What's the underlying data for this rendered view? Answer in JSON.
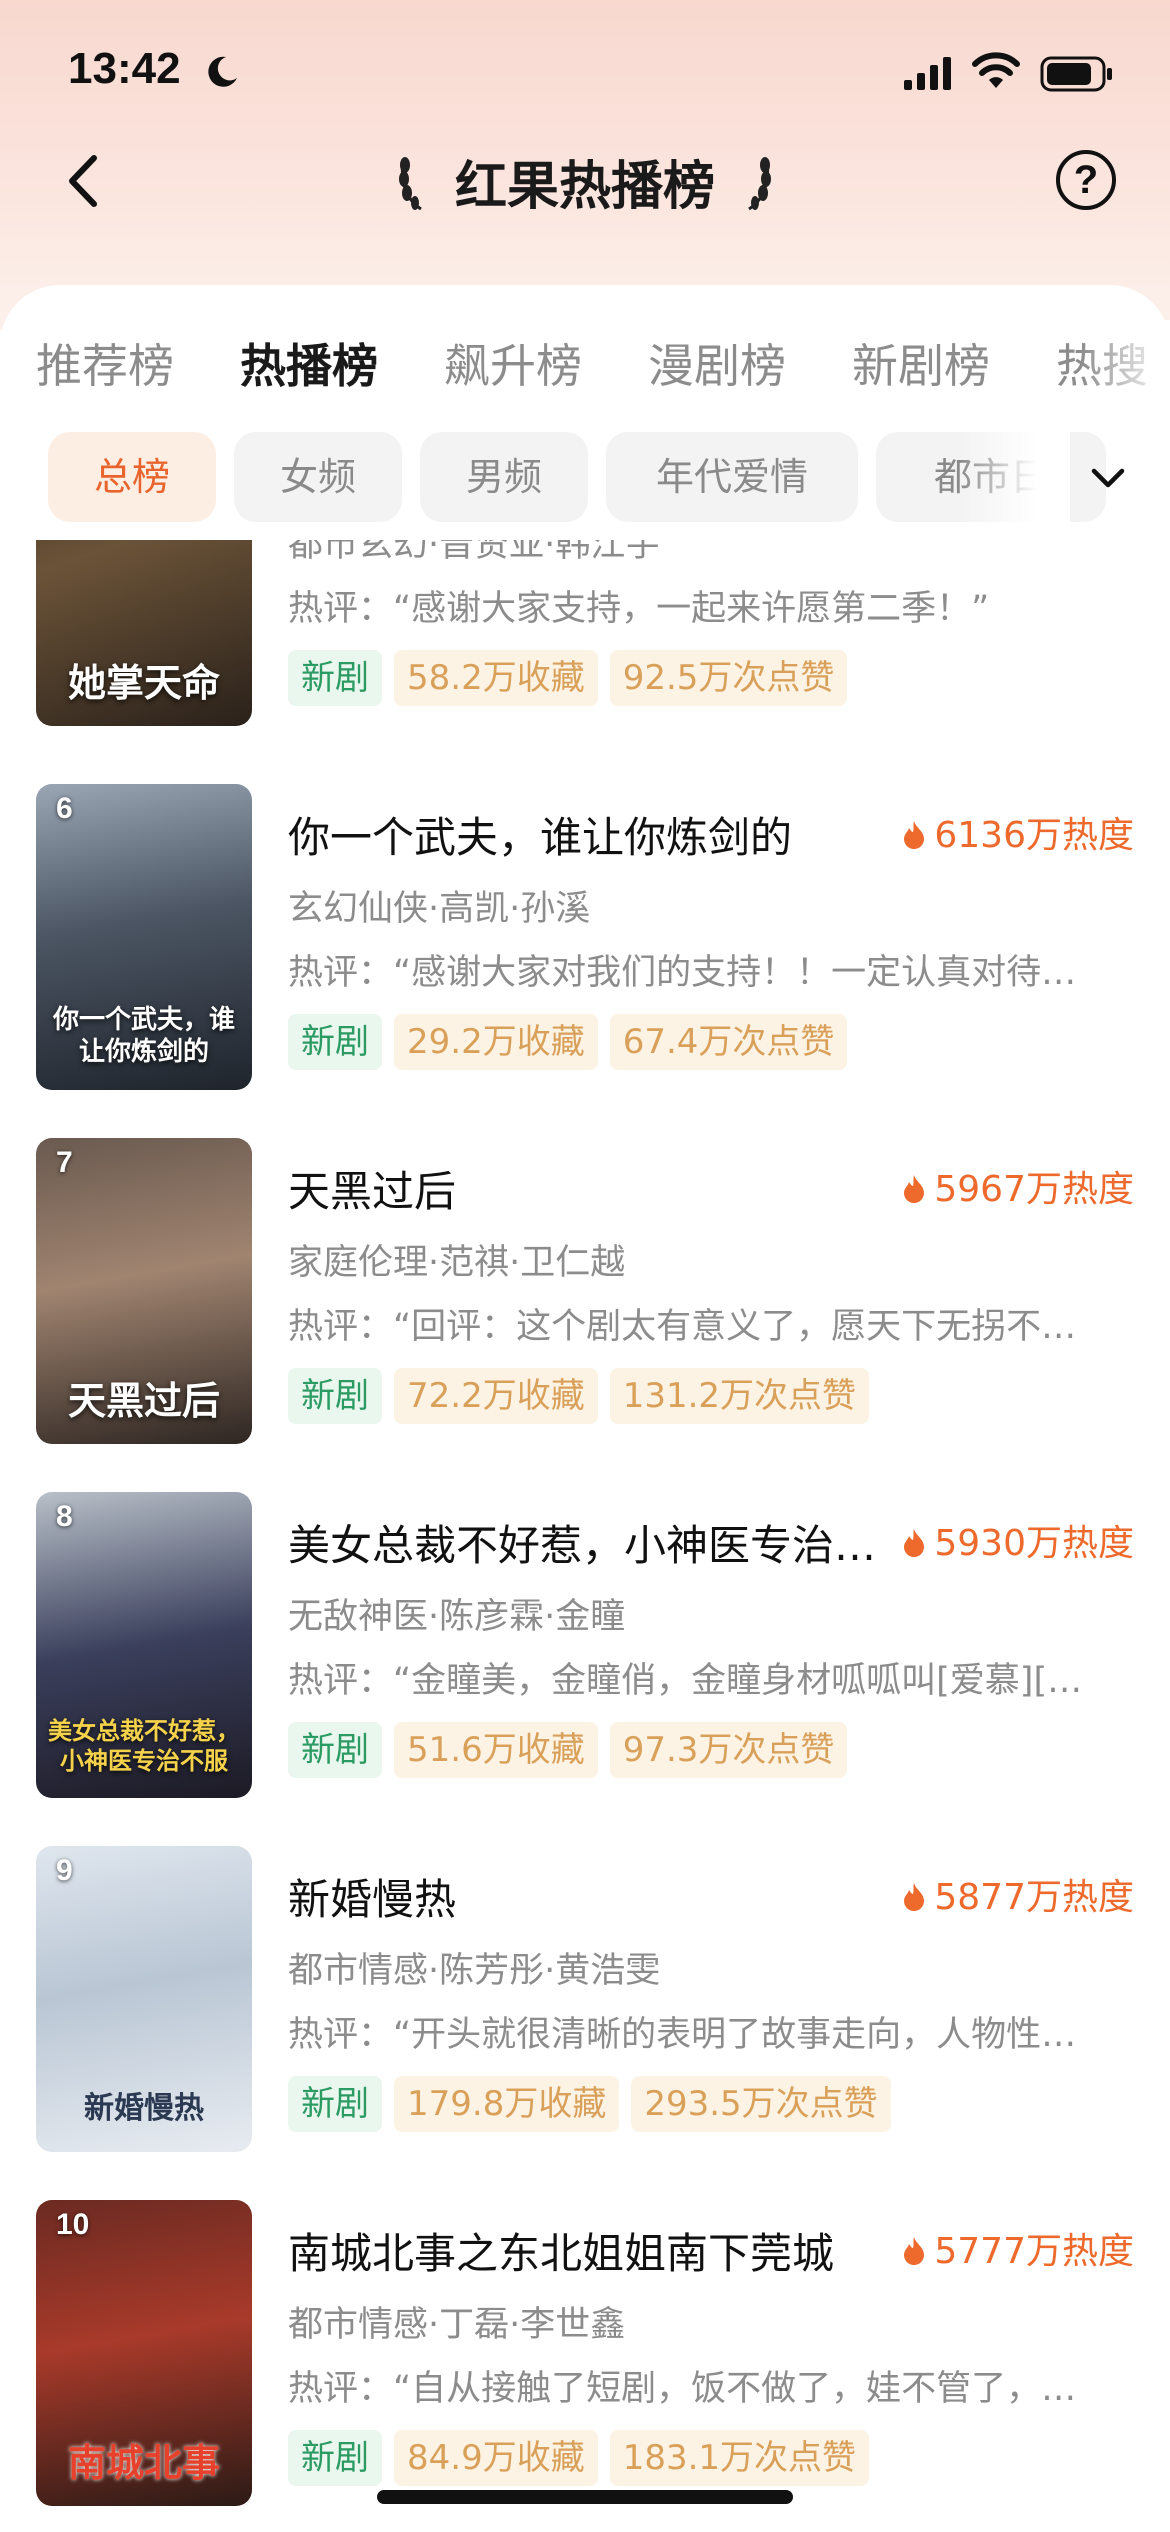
{
  "status_bar": {
    "time": "13:42"
  },
  "header": {
    "title": "红果热播榜"
  },
  "tabs": [
    {
      "label": "推荐榜",
      "active": false
    },
    {
      "label": "热播榜",
      "active": true
    },
    {
      "label": "飙升榜",
      "active": false
    },
    {
      "label": "漫剧榜",
      "active": false
    },
    {
      "label": "新剧榜",
      "active": false
    },
    {
      "label": "热搜",
      "active": false
    }
  ],
  "chips": [
    {
      "label": "总榜",
      "active": true
    },
    {
      "label": "女频",
      "active": false
    },
    {
      "label": "男频",
      "active": false
    },
    {
      "label": "年代爱情",
      "active": false
    },
    {
      "label": "都市日",
      "active": false
    }
  ],
  "items": [
    {
      "rank": "",
      "poster_text": "她掌天命",
      "title": "",
      "heat": "",
      "meta": "都市玄幻·晋贤亚·韩江宇",
      "review": "热评：“感谢大家支持，一起来许愿第二季！”",
      "tag_new": "新剧",
      "favorites": "58.2万收藏",
      "likes": "92.5万次点赞"
    },
    {
      "rank": "6",
      "poster_text": "你一个武夫，谁让你炼剑的",
      "title": "你一个武夫，谁让你炼剑的",
      "heat": "6136万热度",
      "meta": "玄幻仙侠·高凯·孙溪",
      "review": "热评：“感谢大家对我们的支持！！一定认真对待每一部作品”",
      "tag_new": "新剧",
      "favorites": "29.2万收藏",
      "likes": "67.4万次点赞"
    },
    {
      "rank": "7",
      "poster_text": "天黑过后",
      "title": "天黑过后",
      "heat": "5967万热度",
      "meta": "家庭伦理·范祺·卫仁越",
      "review": "热评：“回评：这个剧太有意义了，愿天下无拐不再有分离”",
      "tag_new": "新剧",
      "favorites": "72.2万收藏",
      "likes": "131.2万次点赞"
    },
    {
      "rank": "8",
      "poster_text": "美女总裁不好惹，小神医专治不服",
      "title": "美女总裁不好惹，小神医专治不服",
      "heat": "5930万热度",
      "meta": "无敌神医·陈彦霖·金瞳",
      "review": "热评：“金瞳美，金瞳俏，金瞳身材呱呱叫[爱慕][爱慕]”",
      "tag_new": "新剧",
      "favorites": "51.6万收藏",
      "likes": "97.3万次点赞"
    },
    {
      "rank": "9",
      "poster_text": "新婚慢热",
      "title": "新婚慢热",
      "heat": "5877万热度",
      "meta": "都市情感·陈芳彤·黄浩雯",
      "review": "热评：“开头就很清晰的表明了故事走向，人物性格鲜明”",
      "tag_new": "新剧",
      "favorites": "179.8万收藏",
      "likes": "293.5万次点赞"
    },
    {
      "rank": "10",
      "poster_text": "南城北事",
      "title": "南城北事之东北姐姐南下莞城",
      "heat": "5777万热度",
      "meta": "都市情感·丁磊·李世鑫",
      "review": "热评：“自从接触了短剧，饭不做了，娃不管了，天天追剧”",
      "tag_new": "新剧",
      "favorites": "84.9万收藏",
      "likes": "183.1万次点赞"
    }
  ],
  "colors": {
    "accent": "#ee6a2c",
    "header_bg": "#f8d8cf",
    "tag_new_bg": "#eaf7ef",
    "tag_new_text": "#2c9b63",
    "tag_stat_bg": "#fdf3e4",
    "tag_stat_text": "#d9a05a"
  }
}
